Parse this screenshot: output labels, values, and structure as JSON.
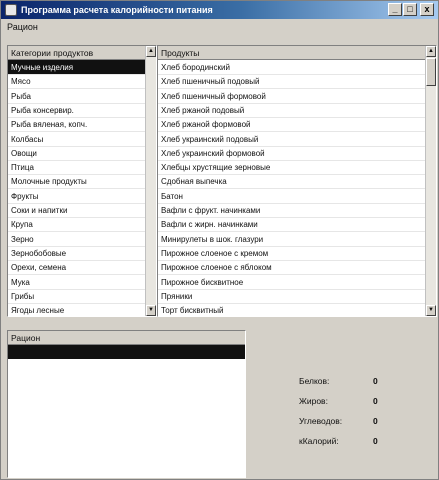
{
  "window": {
    "title": "Программа расчета калорийности питания",
    "minimize_label": "_",
    "maximize_label": "□",
    "close_label": "x"
  },
  "menu": {
    "items": [
      "Рацион"
    ]
  },
  "categories": {
    "header": "Категории продуктов",
    "selected_index": 0,
    "items": [
      "Мучные изделия",
      "Мясо",
      "Рыба",
      "Рыба консервир.",
      "Рыба вяленая, копч.",
      "Колбасы",
      "Овощи",
      "Птица",
      "Молочные продукты",
      "Фрукты",
      "Соки и напитки",
      "Крупа",
      "Зерно",
      "Зернобобовые",
      "Орехи, семена",
      "Мука",
      "Грибы",
      "Ягоды лесные"
    ]
  },
  "products": {
    "header": "Продукты",
    "items": [
      "Хлеб бородинский",
      "Хлеб пшеничный подовый",
      "Хлеб пшеничный формовой",
      "Хлеб ржаной подовый",
      "Хлеб ржаной формовой",
      "Хлеб украинский подовый",
      "Хлеб украинский формовой",
      "Хлебцы хрустящие зерновые",
      "Сдобная выпечка",
      "Батон",
      "Вафли с фрукт. начинками",
      "Вафли с жирн. начинками",
      "Минирулеты в шок. глазури",
      "Пирожное слоеное с кремом",
      "Пирожное слоеное с яблоком",
      "Пирожное бисквитное",
      "Пряники",
      "Торт бисквитный"
    ]
  },
  "ration": {
    "header": "Рацион"
  },
  "nutrients": [
    {
      "label": "Белков:",
      "value": "0"
    },
    {
      "label": "Жиров:",
      "value": "0"
    },
    {
      "label": "Углеводов:",
      "value": "0"
    },
    {
      "label": "кКалорий:",
      "value": "0"
    }
  ],
  "icons": {
    "scroll_up": "▲",
    "scroll_down": "▼",
    "header_sort": "▲"
  }
}
